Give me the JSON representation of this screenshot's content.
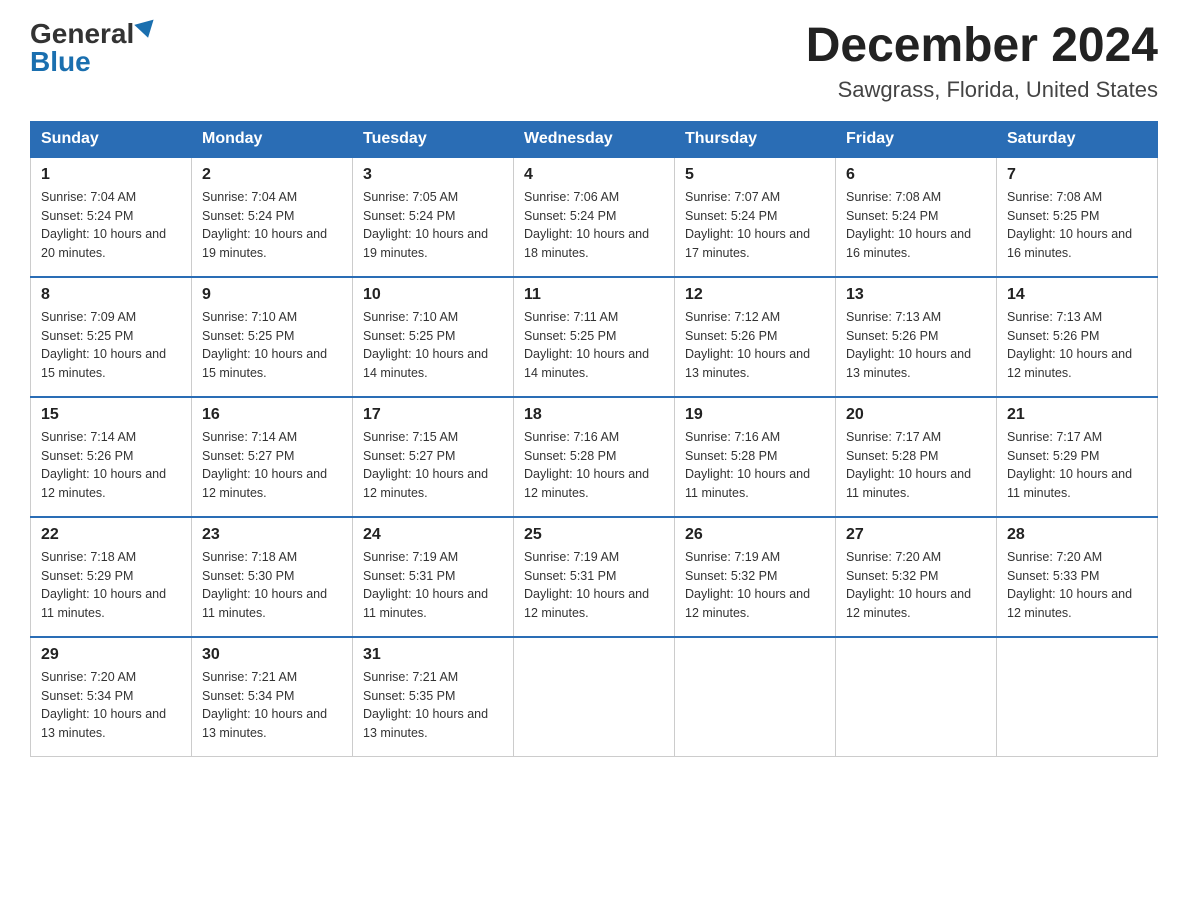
{
  "logo": {
    "general": "General",
    "blue": "Blue"
  },
  "title": "December 2024",
  "location": "Sawgrass, Florida, United States",
  "days_of_week": [
    "Sunday",
    "Monday",
    "Tuesday",
    "Wednesday",
    "Thursday",
    "Friday",
    "Saturday"
  ],
  "weeks": [
    [
      {
        "day": "1",
        "sunrise": "7:04 AM",
        "sunset": "5:24 PM",
        "daylight": "10 hours and 20 minutes."
      },
      {
        "day": "2",
        "sunrise": "7:04 AM",
        "sunset": "5:24 PM",
        "daylight": "10 hours and 19 minutes."
      },
      {
        "day": "3",
        "sunrise": "7:05 AM",
        "sunset": "5:24 PM",
        "daylight": "10 hours and 19 minutes."
      },
      {
        "day": "4",
        "sunrise": "7:06 AM",
        "sunset": "5:24 PM",
        "daylight": "10 hours and 18 minutes."
      },
      {
        "day": "5",
        "sunrise": "7:07 AM",
        "sunset": "5:24 PM",
        "daylight": "10 hours and 17 minutes."
      },
      {
        "day": "6",
        "sunrise": "7:08 AM",
        "sunset": "5:24 PM",
        "daylight": "10 hours and 16 minutes."
      },
      {
        "day": "7",
        "sunrise": "7:08 AM",
        "sunset": "5:25 PM",
        "daylight": "10 hours and 16 minutes."
      }
    ],
    [
      {
        "day": "8",
        "sunrise": "7:09 AM",
        "sunset": "5:25 PM",
        "daylight": "10 hours and 15 minutes."
      },
      {
        "day": "9",
        "sunrise": "7:10 AM",
        "sunset": "5:25 PM",
        "daylight": "10 hours and 15 minutes."
      },
      {
        "day": "10",
        "sunrise": "7:10 AM",
        "sunset": "5:25 PM",
        "daylight": "10 hours and 14 minutes."
      },
      {
        "day": "11",
        "sunrise": "7:11 AM",
        "sunset": "5:25 PM",
        "daylight": "10 hours and 14 minutes."
      },
      {
        "day": "12",
        "sunrise": "7:12 AM",
        "sunset": "5:26 PM",
        "daylight": "10 hours and 13 minutes."
      },
      {
        "day": "13",
        "sunrise": "7:13 AM",
        "sunset": "5:26 PM",
        "daylight": "10 hours and 13 minutes."
      },
      {
        "day": "14",
        "sunrise": "7:13 AM",
        "sunset": "5:26 PM",
        "daylight": "10 hours and 12 minutes."
      }
    ],
    [
      {
        "day": "15",
        "sunrise": "7:14 AM",
        "sunset": "5:26 PM",
        "daylight": "10 hours and 12 minutes."
      },
      {
        "day": "16",
        "sunrise": "7:14 AM",
        "sunset": "5:27 PM",
        "daylight": "10 hours and 12 minutes."
      },
      {
        "day": "17",
        "sunrise": "7:15 AM",
        "sunset": "5:27 PM",
        "daylight": "10 hours and 12 minutes."
      },
      {
        "day": "18",
        "sunrise": "7:16 AM",
        "sunset": "5:28 PM",
        "daylight": "10 hours and 12 minutes."
      },
      {
        "day": "19",
        "sunrise": "7:16 AM",
        "sunset": "5:28 PM",
        "daylight": "10 hours and 11 minutes."
      },
      {
        "day": "20",
        "sunrise": "7:17 AM",
        "sunset": "5:28 PM",
        "daylight": "10 hours and 11 minutes."
      },
      {
        "day": "21",
        "sunrise": "7:17 AM",
        "sunset": "5:29 PM",
        "daylight": "10 hours and 11 minutes."
      }
    ],
    [
      {
        "day": "22",
        "sunrise": "7:18 AM",
        "sunset": "5:29 PM",
        "daylight": "10 hours and 11 minutes."
      },
      {
        "day": "23",
        "sunrise": "7:18 AM",
        "sunset": "5:30 PM",
        "daylight": "10 hours and 11 minutes."
      },
      {
        "day": "24",
        "sunrise": "7:19 AM",
        "sunset": "5:31 PM",
        "daylight": "10 hours and 11 minutes."
      },
      {
        "day": "25",
        "sunrise": "7:19 AM",
        "sunset": "5:31 PM",
        "daylight": "10 hours and 12 minutes."
      },
      {
        "day": "26",
        "sunrise": "7:19 AM",
        "sunset": "5:32 PM",
        "daylight": "10 hours and 12 minutes."
      },
      {
        "day": "27",
        "sunrise": "7:20 AM",
        "sunset": "5:32 PM",
        "daylight": "10 hours and 12 minutes."
      },
      {
        "day": "28",
        "sunrise": "7:20 AM",
        "sunset": "5:33 PM",
        "daylight": "10 hours and 12 minutes."
      }
    ],
    [
      {
        "day": "29",
        "sunrise": "7:20 AM",
        "sunset": "5:34 PM",
        "daylight": "10 hours and 13 minutes."
      },
      {
        "day": "30",
        "sunrise": "7:21 AM",
        "sunset": "5:34 PM",
        "daylight": "10 hours and 13 minutes."
      },
      {
        "day": "31",
        "sunrise": "7:21 AM",
        "sunset": "5:35 PM",
        "daylight": "10 hours and 13 minutes."
      },
      null,
      null,
      null,
      null
    ]
  ],
  "labels": {
    "sunrise": "Sunrise:",
    "sunset": "Sunset:",
    "daylight": "Daylight:"
  }
}
